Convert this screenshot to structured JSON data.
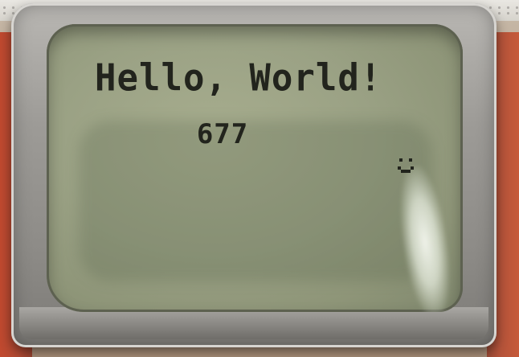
{
  "display": {
    "line1": "Hello, World!",
    "line2": "677"
  },
  "icons": {
    "line2_symbol": "smiley-icon"
  },
  "colors": {
    "lcd": "#9aa184",
    "text": "#22241d",
    "bezel": "#9d9b97",
    "pcb": "#b24a33"
  }
}
